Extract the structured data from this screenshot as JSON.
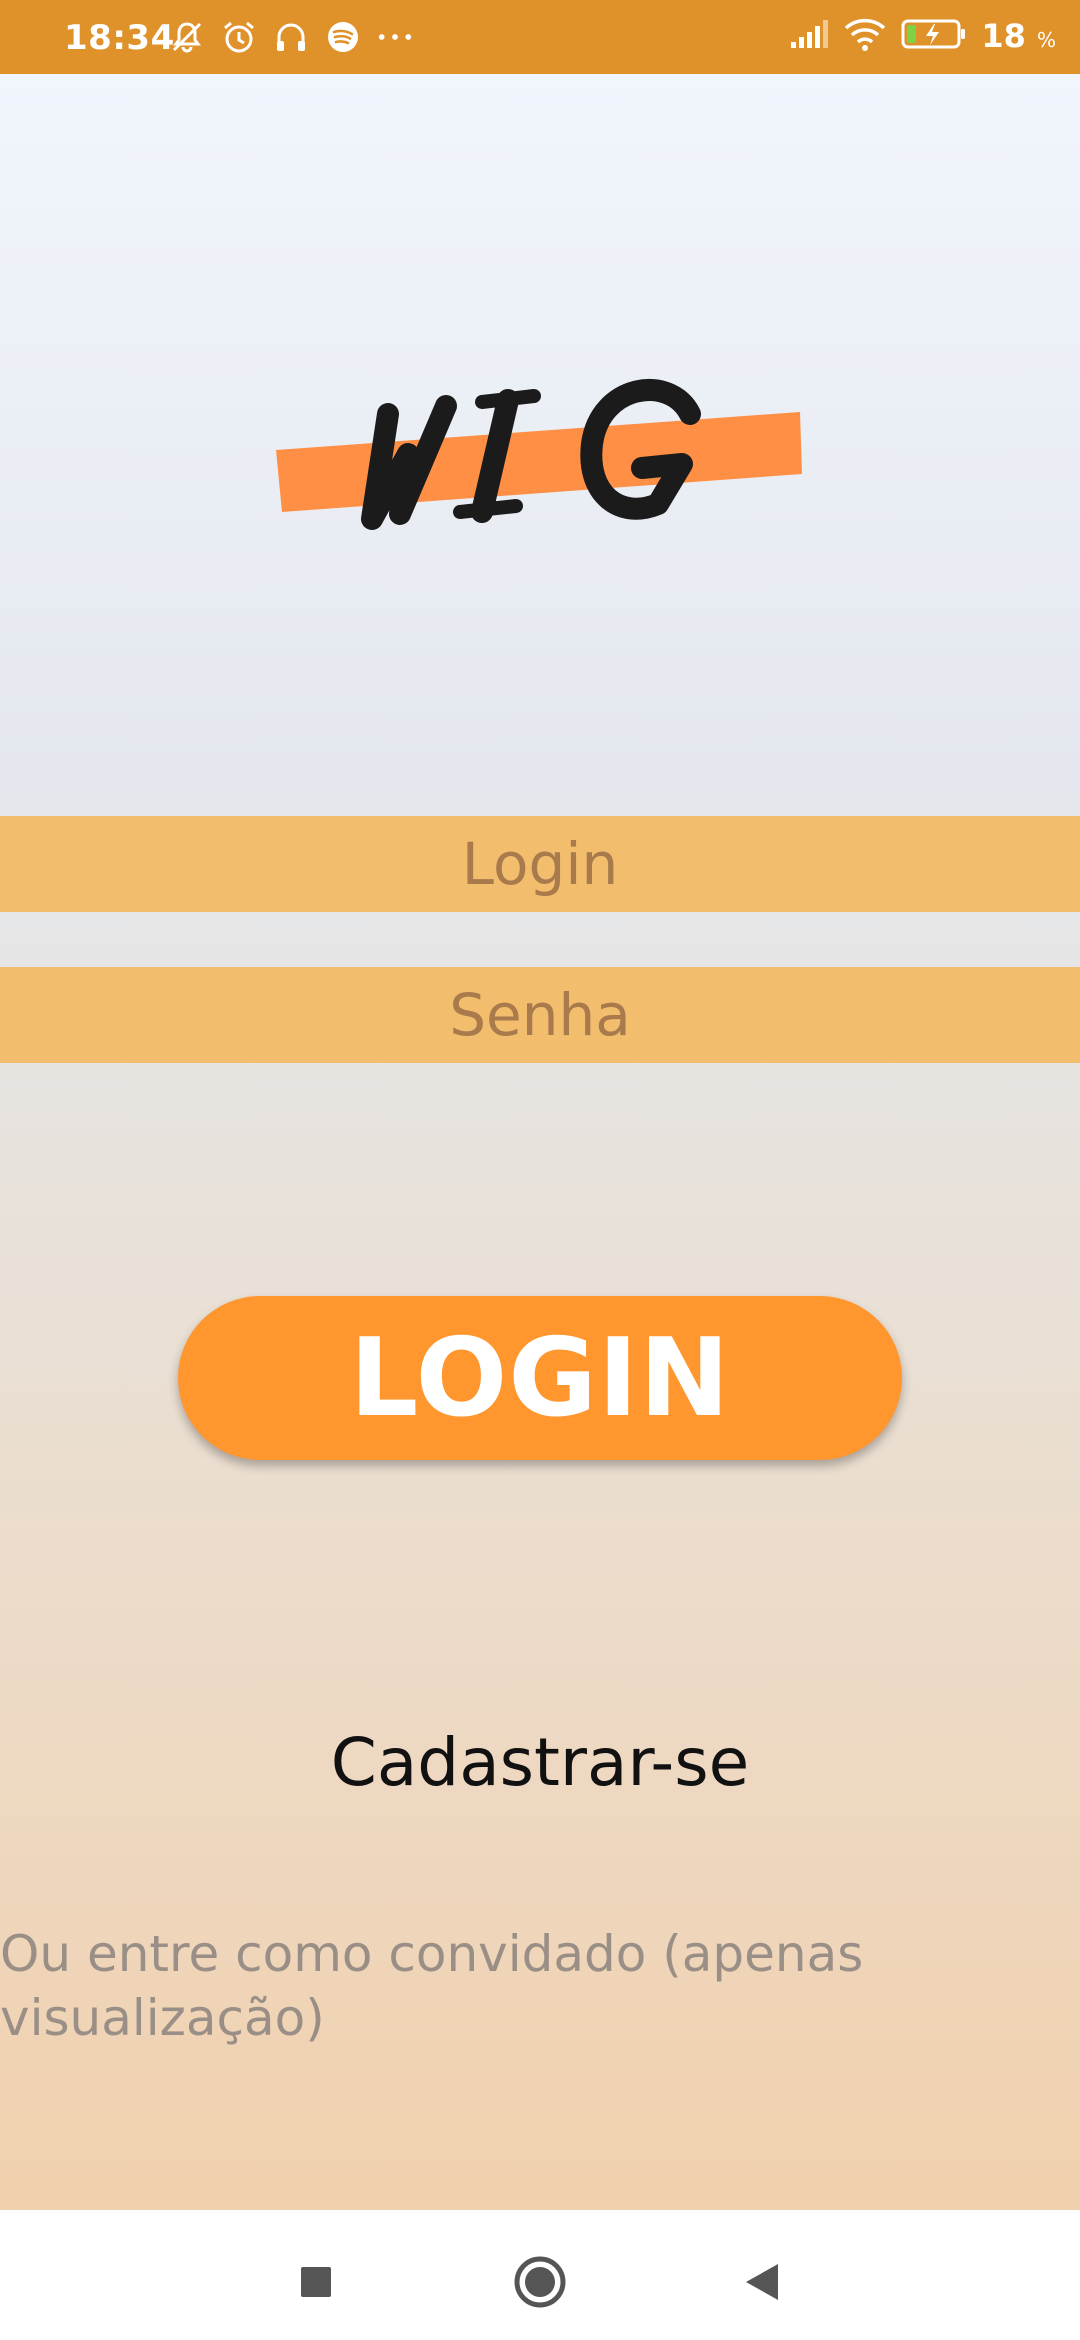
{
  "status_bar": {
    "time": "18:34",
    "battery_percent": "18",
    "battery_unit": "%",
    "icons": [
      "mute-icon",
      "alarm-icon",
      "headphones-icon",
      "spotify-icon",
      "more-icon",
      "signal-icon",
      "wifi-icon",
      "battery-charging-icon"
    ],
    "background": "#e0922a"
  },
  "logo": {
    "text": "WIG",
    "stripe_color": "#ff8f45"
  },
  "form": {
    "login_placeholder": "Login",
    "password_placeholder": "Senha",
    "field_color": "#f2bd6d"
  },
  "actions": {
    "login_button": "LOGIN",
    "login_button_color": "#ff962e",
    "register_link": "Cadastrar-se",
    "guest_link": "Ou entre como convidado (apenas visualização)"
  },
  "nav_bar": {
    "buttons": [
      "recent-apps-icon",
      "home-icon",
      "back-icon"
    ]
  }
}
